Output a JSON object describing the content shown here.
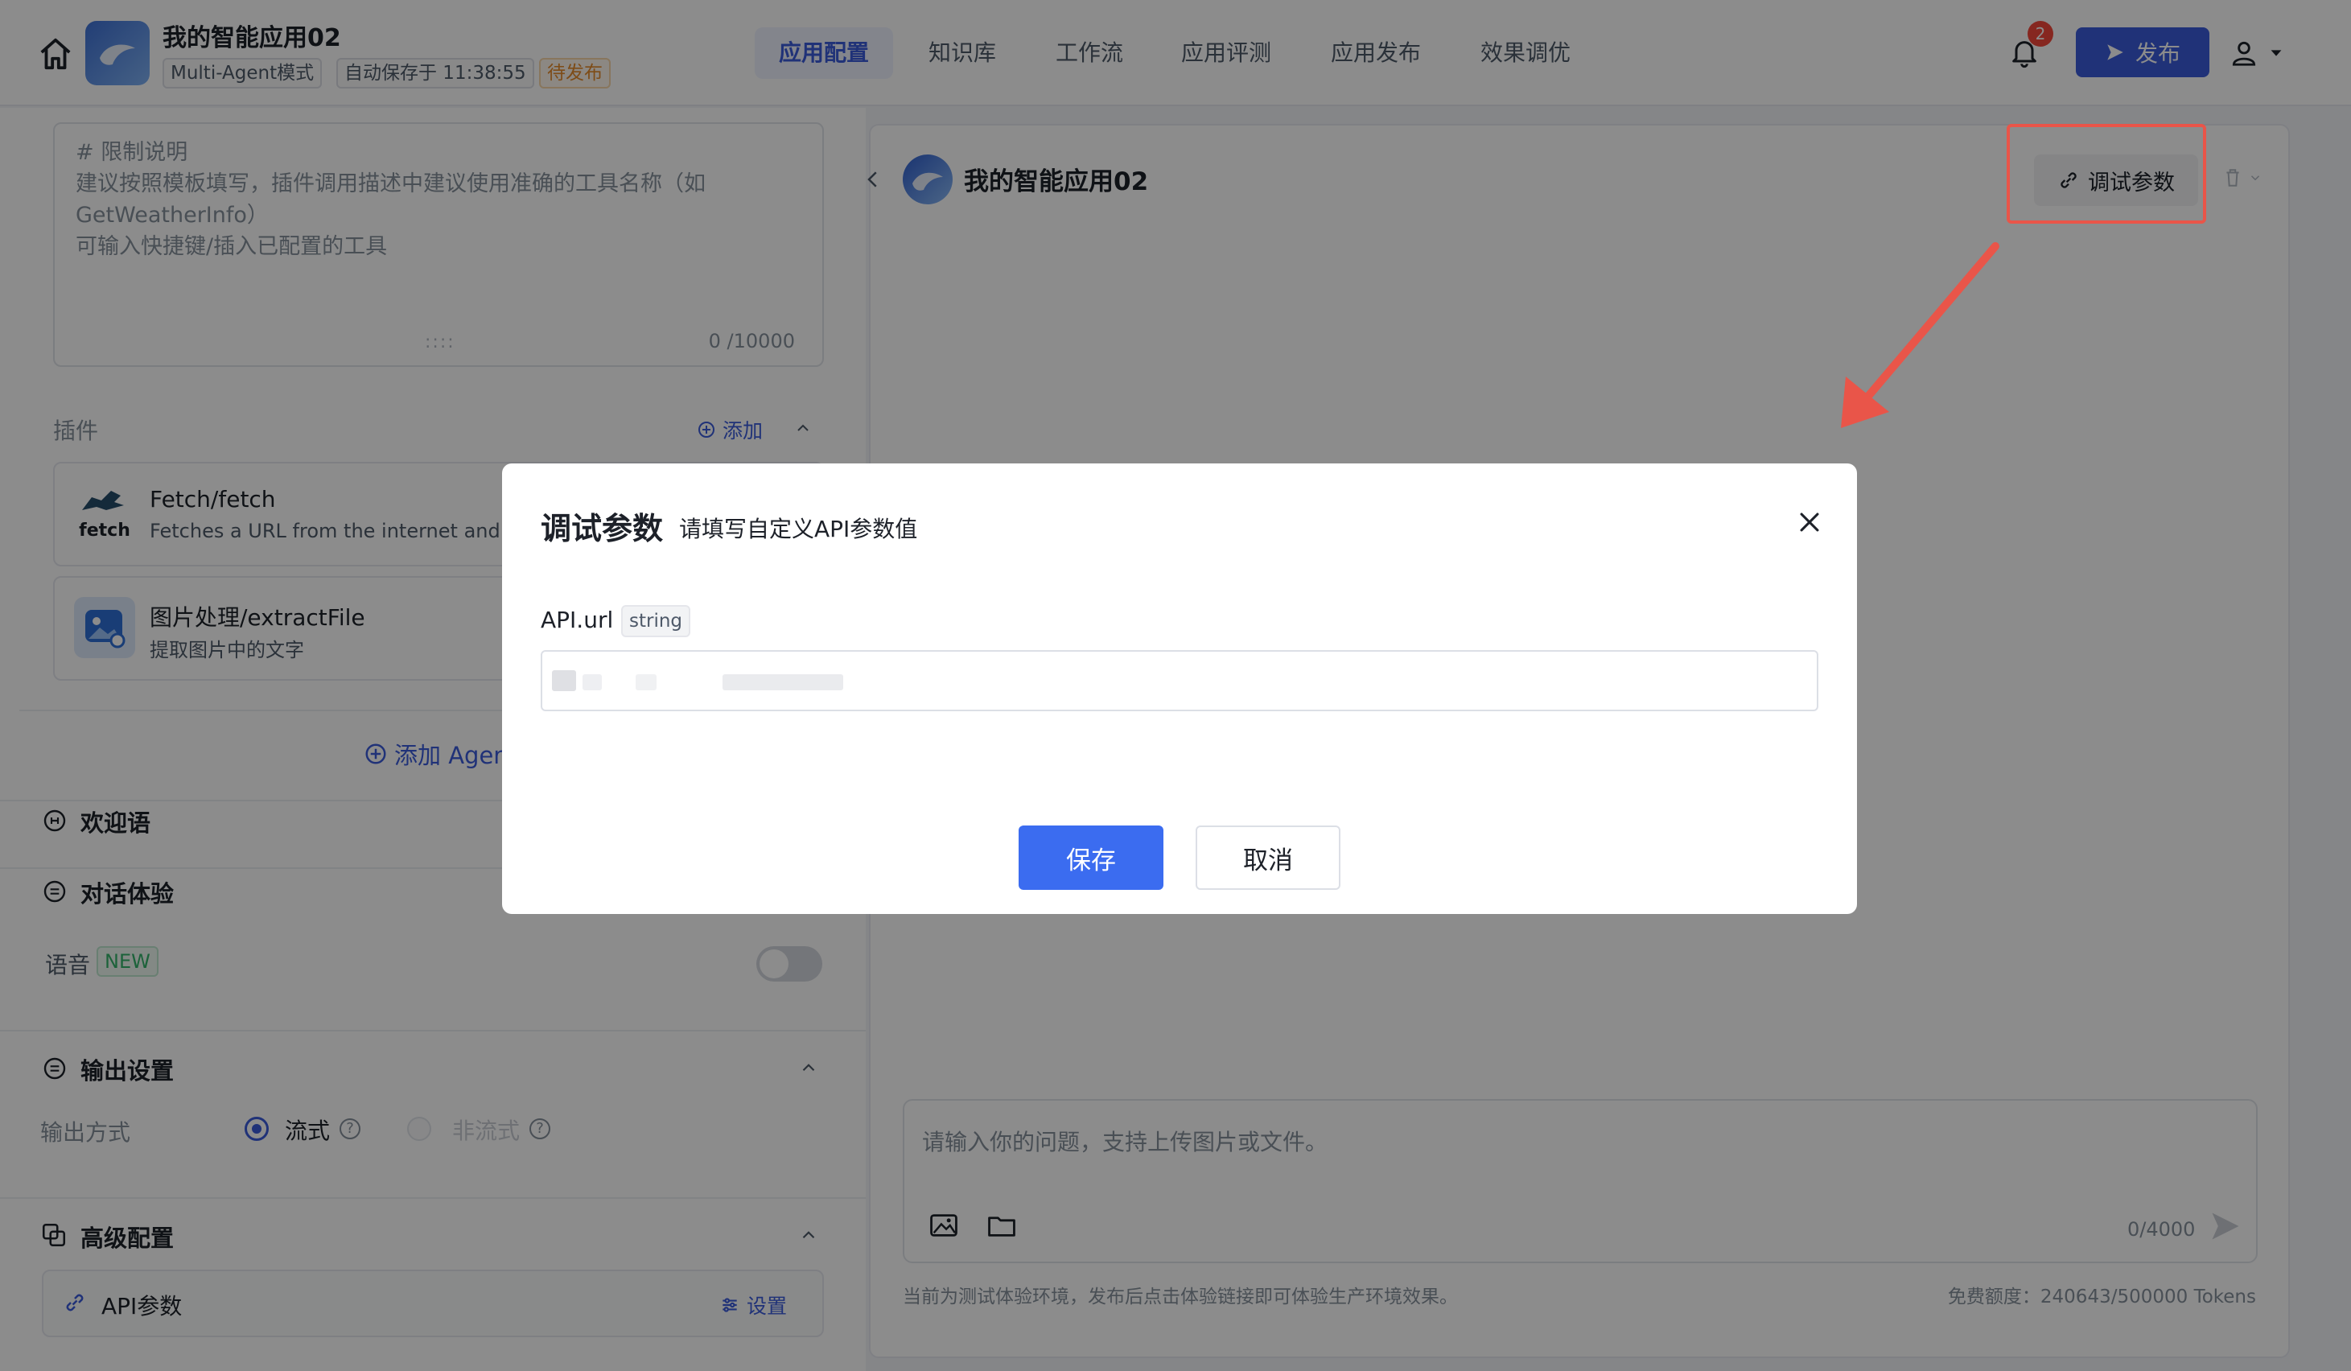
{
  "header": {
    "app_title": "我的智能应用02",
    "mode_tag": "Multi-Agent模式",
    "autosave_tag": "自动保存于 11:38:55",
    "status_tag": "待发布",
    "nav_tabs": [
      {
        "label": "应用配置"
      },
      {
        "label": "知识库"
      },
      {
        "label": "工作流"
      },
      {
        "label": "应用评测"
      },
      {
        "label": "应用发布"
      },
      {
        "label": "效果调优"
      }
    ],
    "notification_count": "2",
    "publish_label": "发布"
  },
  "left": {
    "prompt_text": "# 限制说明\n建议按照模板填写，插件调用描述中建议使用准确的工具名称（如GetWeatherInfo）\n可输入快捷键/插入已配置的工具",
    "prompt_counter": "0 /10000",
    "plugins_label": "插件",
    "add_label": "添加",
    "plugins": [
      {
        "name": "Fetch/fetch",
        "desc": "Fetches a URL from the internet and op",
        "icon_text": "fetch"
      },
      {
        "name": "图片处理/extractFile",
        "desc": "提取图片中的文字"
      }
    ],
    "add_agent_label": "添加 Agen",
    "welcome_label": "欢迎语",
    "dialog_label": "对话体验",
    "voice_label": "语音",
    "new_tag": "NEW",
    "output_settings_label": "输出设置",
    "output_mode_label": "输出方式",
    "stream_label": "流式",
    "nonstream_label": "非流式",
    "advanced_label": "高级配置",
    "api_params_label": "API参数",
    "settings_label": "设置"
  },
  "right": {
    "chat_title": "我的智能应用02",
    "debug_params_label": "调试参数",
    "input_placeholder": "请输入你的问题，支持上传图片或文件。",
    "input_counter": "0/4000",
    "env_note": "当前为测试体验环境，发布后点击体验链接即可体验生产环境效果。",
    "quota_note": "免费额度：240643/500000 Tokens"
  },
  "modal": {
    "title": "调试参数",
    "subtitle": "请填写自定义API参数值",
    "field_label": "API.url",
    "field_type": "string",
    "field_value": "",
    "save_label": "保存",
    "cancel_label": "取消"
  },
  "colors": {
    "accent": "#3b5bdb",
    "highlight_red": "#e95549",
    "pending_orange": "#e58a2b",
    "new_green": "#34b36b"
  }
}
